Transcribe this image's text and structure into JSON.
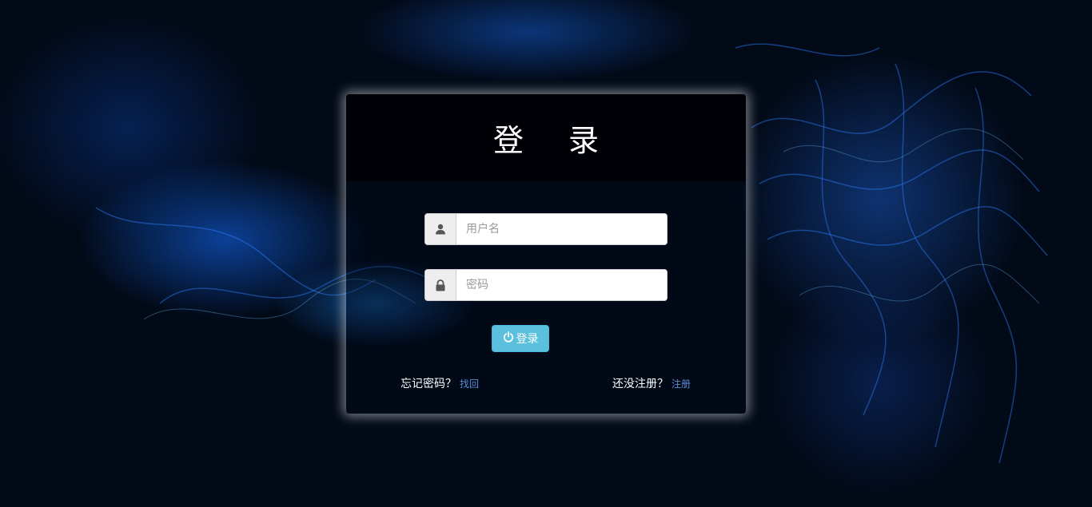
{
  "login_panel": {
    "title": "登  录",
    "username": {
      "placeholder": "用户名",
      "value": "",
      "icon": "user-icon"
    },
    "password": {
      "placeholder": "密码",
      "value": "",
      "icon": "lock-icon"
    },
    "submit": {
      "label": "登录",
      "icon": "power-icon"
    },
    "forgot": {
      "text": "忘记密码？",
      "link": "找回"
    },
    "register": {
      "text": "还没注册？",
      "link": "注册"
    }
  },
  "colors": {
    "background": "#020a18",
    "header": "#000007",
    "button": "#5bc0de",
    "link": "#5a8fd6"
  }
}
